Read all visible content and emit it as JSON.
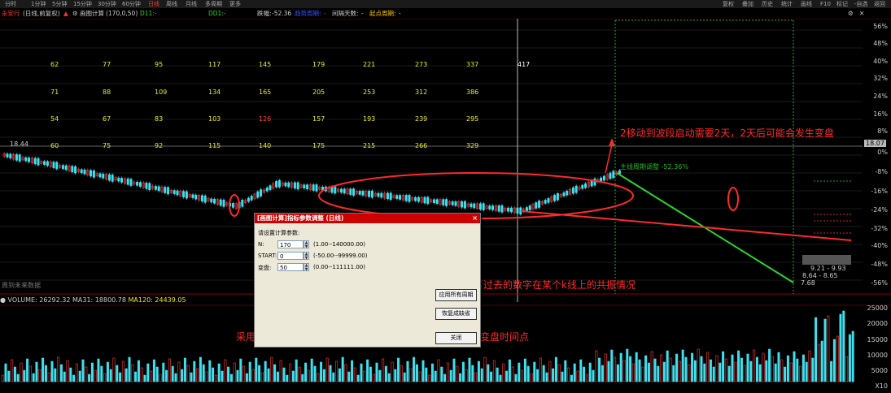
{
  "toolbar": {
    "left_items": [
      "分时",
      "1分钟",
      "5分钟",
      "15分钟",
      "30分钟",
      "60分钟",
      "日线",
      "周线",
      "月线",
      "多周期",
      "更多"
    ],
    "active_item": "日线",
    "right_items": [
      "复权",
      "叠加",
      "历史",
      "统计",
      "画线",
      "F10",
      "标记",
      "-自选",
      "返回"
    ]
  },
  "infobar": {
    "stock": "永安行",
    "period": "(日线,前复权)",
    "indicator": "画图计算",
    "indicator_params": "(170,0,50)",
    "d11_label": "D11:",
    "d11_value": "-",
    "dd1_label": "DD1:",
    "dd1_value": "-",
    "drop_label": "跌幅:",
    "drop_value": "-52.36",
    "blue_label": "趋势周期:",
    "blue_value": "-",
    "interval_label": "间隔天数:",
    "interval_value": "-",
    "start_label": "起点周期:",
    "start_value": "-"
  },
  "price_levels": {
    "high": "18.44",
    "right_top": "18.07",
    "low": "7.68"
  },
  "percent_axis": [
    "56%",
    "48%",
    "40%",
    "32%",
    "24%",
    "16%",
    "8%",
    "0%",
    "-8%",
    "-16%",
    "-24%",
    "-32%",
    "-40%",
    "-48%",
    "-56%"
  ],
  "number_rows": [
    {
      "color": "#e8e82a",
      "values": [
        "62",
        "77",
        "95",
        "117",
        "145",
        "179",
        "221",
        "273",
        "337",
        "417"
      ]
    },
    {
      "color": "#e8e82a",
      "values": [
        "71",
        "88",
        "109",
        "134",
        "165",
        "205",
        "253",
        "312",
        "386"
      ]
    },
    {
      "color": "#e8e82a",
      "values": [
        "54",
        "67",
        "83",
        "103",
        "126",
        "157",
        "193",
        "239",
        "295"
      ]
    },
    {
      "color": "#e8e82a",
      "values": [
        "60",
        "75",
        "92",
        "115",
        "140",
        "175",
        "215",
        "266",
        "329"
      ]
    }
  ],
  "chart_labels": {
    "future_data": "周到未来数据",
    "range1": "9.21 - 9.93",
    "range2": "8.64 - 8.65",
    "green_text": "主线周期调整 -52.36%"
  },
  "volume": {
    "label": "VOLUME:",
    "value": "26292.32",
    "ma31_label": "MA31:",
    "ma31_value": "18800.78",
    "ma120_label": "MA120:",
    "ma120_value": "24439.05",
    "axis": [
      "25000",
      "20000",
      "15000",
      "10000",
      "5000"
    ],
    "unit": "X10"
  },
  "dialog": {
    "title": "[画图计算]指标参数调整 (日线)",
    "close": "×",
    "prompt": "请设置计算参数:",
    "params": [
      {
        "label": "N:",
        "value": "170",
        "range": "(1.00--140000.00)"
      },
      {
        "label": "START:",
        "value": "0",
        "range": "(-50.00--99999.00)"
      },
      {
        "label": "变盘:",
        "value": "50",
        "range": "(0.00--111111.00)"
      }
    ],
    "buttons": [
      "应用所有周期",
      "恢复成缺省",
      "关闭"
    ]
  },
  "annotations": {
    "top": "2移动到波段启动需要2天，2天后可能会发生变盘",
    "middle": "可调落点位置可以查看将来或者过去的数字在某个k线上的共振情况",
    "bottom": "采用一个波段天数，或者两个高点或者低点天数进行测试变盘时间点"
  },
  "colors": {
    "up": "#ff3b3b",
    "down": "#3ee0ee",
    "accent": "#ff2a2a",
    "trend": "#2bd62b"
  }
}
